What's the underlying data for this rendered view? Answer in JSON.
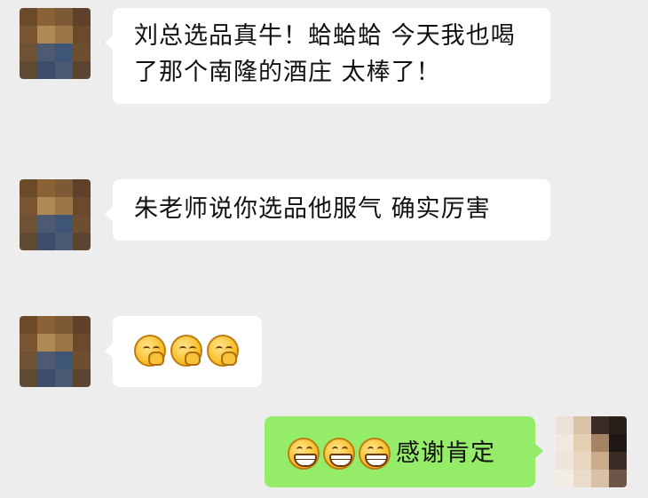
{
  "chat": {
    "messages": [
      {
        "direction": "incoming",
        "text": "刘总选品真牛！蛤蛤蛤 今天我也喝了那个南隆的酒庄 太棒了！"
      },
      {
        "direction": "incoming",
        "text": "朱老师说你选品他服气 确实厉害"
      },
      {
        "direction": "incoming",
        "emojis": [
          "shy-face-emoji",
          "shy-face-emoji",
          "shy-face-emoji"
        ]
      },
      {
        "direction": "outgoing",
        "emojis": [
          "grin-face-emoji",
          "grin-face-emoji",
          "grin-face-emoji"
        ],
        "text": "感谢肯定"
      }
    ]
  },
  "colors": {
    "background": "#ededed",
    "incoming_bubble": "#ffffff",
    "outgoing_bubble": "#95ec69",
    "text": "#111111"
  }
}
